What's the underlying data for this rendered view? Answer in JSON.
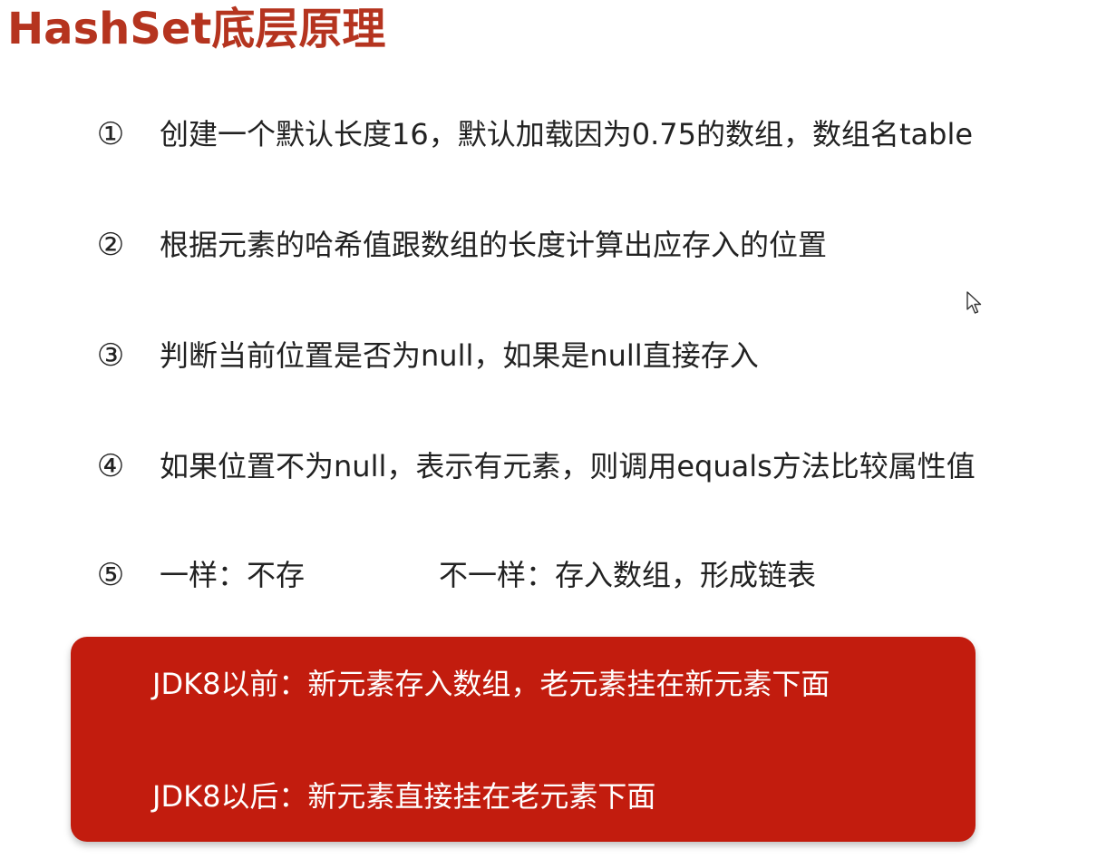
{
  "title": "HashSet底层原理",
  "steps": [
    {
      "number": "①",
      "text": "创建一个默认长度16，默认加载因为0.75的数组，数组名table"
    },
    {
      "number": "②",
      "text": "根据元素的哈希值跟数组的长度计算出应存入的位置"
    },
    {
      "number": "③",
      "text": "判断当前位置是否为null，如果是null直接存入"
    },
    {
      "number": "④",
      "text": "如果位置不为null，表示有元素，则调用equals方法比较属性值"
    },
    {
      "number": "⑤",
      "text": "一样：不存",
      "text_b": "不一样：存入数组，形成链表"
    }
  ],
  "note": {
    "before": "JDK8以前：新元素存入数组，老元素挂在新元素下面",
    "after": "JDK8以后：新元素直接挂在老元素下面"
  },
  "colors": {
    "title": "#b5341f",
    "note_background": "#c21c0e",
    "text": "#222222",
    "note_text": "#ffffff"
  },
  "icons": {
    "cursor": "mouse-pointer-icon"
  }
}
